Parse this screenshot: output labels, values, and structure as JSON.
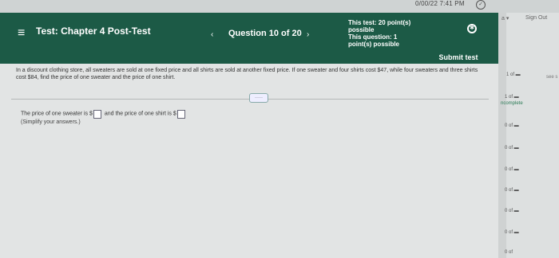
{
  "system": {
    "clock": "0/00/22 7:41 PM"
  },
  "header": {
    "title": "Test: Chapter 4 Post-Test",
    "question_nav": "Question 10 of 20",
    "score_line1": "This test: 20 point(s)",
    "score_line2": "possible",
    "score_line3": "This question: 1",
    "score_line4": "point(s) possible",
    "submit_label": "Submit test"
  },
  "question": {
    "text": "In a discount clothing store, all sweaters are sold at one fixed price and all shirts are sold at another fixed price. If one sweater and four shirts cost $47, while four sweaters and three shirts cost $84, find the price of one sweater and the price of one shirt.",
    "more_label": "·····",
    "answer_prefix": "The price of one sweater is $",
    "answer_middle": "and the price of one shirt is $",
    "simplify_note": "(Simplify your answers.)"
  },
  "sidebar": {
    "user_label": "a ▾",
    "signout_label": "Sign Out",
    "see_label": "see s",
    "statuses": [
      {
        "label": "1 of ▬"
      },
      {
        "label": "1 of ▬"
      },
      {
        "label": "ncomplete"
      },
      {
        "label": "0 of ▬"
      },
      {
        "label": "0 of ▬"
      },
      {
        "label": "0 of ▬"
      },
      {
        "label": "0 of ▬"
      },
      {
        "label": "0 of ▬"
      },
      {
        "label": "0 of ▬"
      },
      {
        "label": "0 of"
      }
    ]
  }
}
